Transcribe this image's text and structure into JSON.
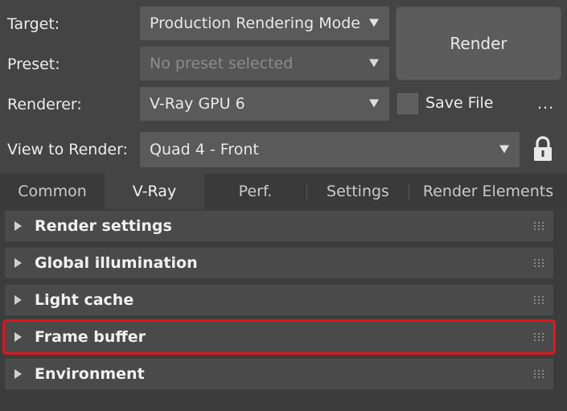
{
  "form": {
    "target_label": "Target:",
    "target_value": "Production Rendering Mode",
    "preset_label": "Preset:",
    "preset_value": "No preset selected",
    "renderer_label": "Renderer:",
    "renderer_value": "V-Ray GPU 6",
    "view_label": "View to Render:",
    "view_value": "Quad 4 - Front"
  },
  "actions": {
    "render_label": "Render",
    "save_file_label": "Save File",
    "save_file_checked": false,
    "more_label": "..."
  },
  "tabs": [
    {
      "label": "Common",
      "active": false
    },
    {
      "label": "V-Ray",
      "active": true
    },
    {
      "label": "Perf.",
      "active": false
    },
    {
      "label": "Settings",
      "active": false
    },
    {
      "label": "Render Elements",
      "active": false
    }
  ],
  "rollouts": [
    {
      "label": "Render settings",
      "highlighted": false
    },
    {
      "label": "Global illumination",
      "highlighted": false
    },
    {
      "label": "Light cache",
      "highlighted": false
    },
    {
      "label": "Frame buffer",
      "highlighted": true
    },
    {
      "label": "Environment",
      "highlighted": false
    }
  ],
  "colors": {
    "highlight": "#e0141e",
    "background": "#444444"
  },
  "icons": {
    "lock": "lock-icon",
    "dropdown": "triangle-down-icon",
    "expand": "triangle-right-icon",
    "grip": "grip-dots-icon"
  }
}
